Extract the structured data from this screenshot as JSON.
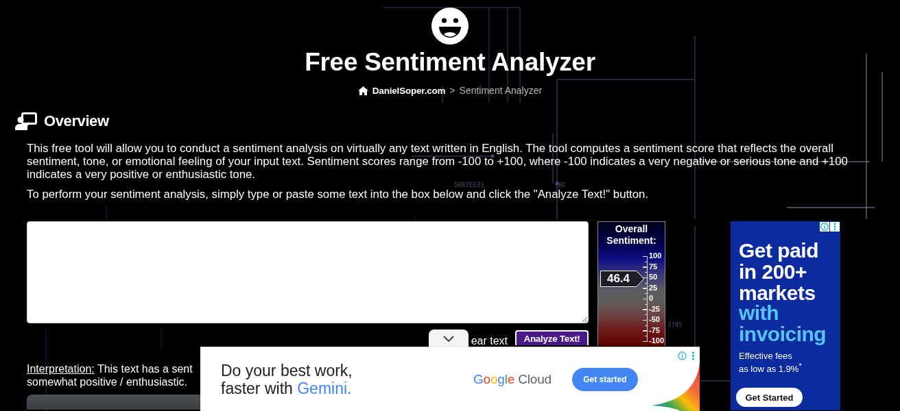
{
  "header": {
    "title": "Free Sentiment Analyzer",
    "breadcrumb": [
      {
        "label": "DanielSoper.com",
        "kind": "home"
      },
      {
        "label": ">",
        "kind": "separator"
      },
      {
        "label": "Sentiment Analyzer",
        "kind": "current"
      }
    ]
  },
  "background_labels": [
    "5B87E633",
    "BC",
    "3745"
  ],
  "overview": {
    "heading": "Overview",
    "paragraphs": [
      "This free tool will allow you to conduct a sentiment analysis on virtually any text written in English. The tool computes a sentiment score that reflects the overall sentiment, tone, or emotional feeling of your input text. Sentiment scores range from -100 to +100, where -100 indicates a very negative or serious tone and +100 indicates a very positive or enthusiastic tone.",
      "To perform your sentiment analysis, simply type or paste some text into the box below and click the \"Analyze Text!\" button."
    ]
  },
  "analyzer": {
    "clear_link": "ear text",
    "analyze_button": "Analyze Text!",
    "interpretation": {
      "label": "Interpretation:",
      "line_1": "This text has a sent",
      "line_2": "somewhat positive / enthusiastic."
    }
  },
  "gauge": {
    "title": "Overall Sentiment:",
    "value": "46.4",
    "level": 0.732,
    "scale_labels": [
      "100",
      "75",
      "50",
      "25",
      "0",
      "-25",
      "-50",
      "-75",
      "-100"
    ]
  },
  "side_ad": {
    "headline": "Get paid in 200+ markets",
    "highlight": "with invoicing",
    "fine_print": "Effective fees as low as 1.9%$^{*}$",
    "button": "Get Started"
  },
  "bottom_ad": {
    "headline": "Do your best work, faster with",
    "highlight": "Gemini.",
    "logo": {
      "mark": "Google",
      "product": "Cloud"
    },
    "button": "Get started"
  }
}
